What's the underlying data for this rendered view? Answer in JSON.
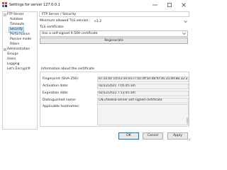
{
  "window": {
    "title": "Settings for server 127.0.0.1",
    "controls": {
      "minimize": "minimize",
      "maximize": "maximize",
      "close": "close"
    }
  },
  "tree": {
    "items": [
      {
        "label": "FTP Server",
        "expander": "minus"
      },
      {
        "label": "Autoban"
      },
      {
        "label": "Timeouts"
      },
      {
        "label": "Security",
        "selected": true
      },
      {
        "label": "Performance"
      },
      {
        "label": "Passive mode"
      },
      {
        "label": "Filters"
      },
      {
        "label": "Administration",
        "expander": "plus"
      },
      {
        "label": "Groups"
      },
      {
        "label": "Users"
      },
      {
        "label": "Logging"
      },
      {
        "label": "Let's Encrypt®"
      }
    ]
  },
  "panel": {
    "heading": "FTP Server / Security",
    "min_tls_label": "Minimum allowed TLS version:",
    "min_tls_value": "v1.2",
    "tls_cert_label": "TLS certificate:",
    "tls_cert_value": "Use a self-signed X.509 certificate",
    "regenerate_label": "Regenerate",
    "cert_info_title": "Information about the certificate",
    "fields": [
      {
        "label": "Fingerprint (SHA-256):",
        "value": "b7:a5:bc:cd:03:50:e5:c7:bc:df:5e:d8:f0:56:35:d9:8b:32:21:21:00:ed:96:89:6c"
      },
      {
        "label": "Activation date:",
        "value": "02/12/2021 7:05:45 am"
      },
      {
        "label": "Expiration date:",
        "value": "02/12/2022 7:13:45 am"
      },
      {
        "label": "Distinguished name:",
        "value": "CN=filezilla-server self signed certificate"
      },
      {
        "label": "Applicable hostnames:",
        "value": ""
      }
    ]
  },
  "footer": {
    "ok_label": "OK",
    "cancel_label": "Cancel",
    "apply_label": "Apply"
  },
  "colors": {
    "selection": "#cce4f7",
    "primary_border": "#0078d7",
    "icon_red": "#e0453b",
    "icon_blue": "#2f6fd1",
    "icon_dark": "#333333"
  }
}
